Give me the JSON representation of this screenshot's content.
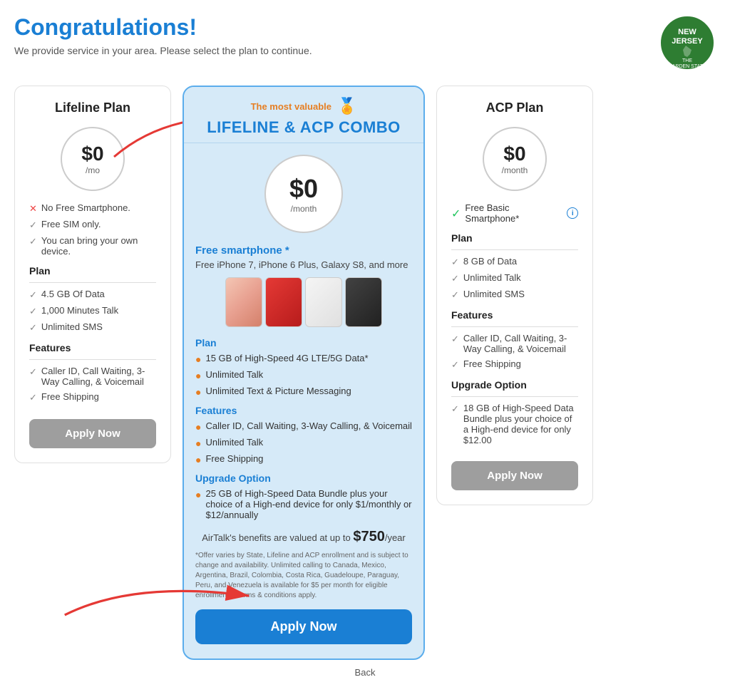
{
  "header": {
    "title": "Congratulations!",
    "subtitle": "We provide service in your area. Please select the plan to continue."
  },
  "lifeline": {
    "title": "Lifeline Plan",
    "price": "$0",
    "period": "/mo",
    "features_top": [
      {
        "type": "cross",
        "text": "No Free Smartphone."
      },
      {
        "type": "check",
        "text": "Free SIM only."
      },
      {
        "type": "check",
        "text": "You can bring your own device."
      }
    ],
    "plan_label": "Plan",
    "plan_items": [
      "4.5 GB Of Data",
      "1,000 Minutes Talk",
      "Unlimited SMS"
    ],
    "features_label": "Features",
    "features_items": [
      "Caller ID, Call Waiting, 3-Way Calling, & Voicemail",
      "Free Shipping"
    ],
    "apply_btn": "Apply Now"
  },
  "combo": {
    "badge": "The most valuable",
    "title": "LIFELINE & ACP COMBO",
    "price": "$0",
    "period": "/month",
    "free_smartphone_label": "Free smartphone *",
    "free_smartphone_desc": "Free iPhone 7, iPhone 6 Plus, Galaxy S8, and more",
    "plan_label": "Plan",
    "plan_items": [
      "15 GB of High-Speed 4G LTE/5G Data*",
      "Unlimited Talk",
      "Unlimited Text & Picture Messaging"
    ],
    "features_label": "Features",
    "features_items": [
      "Caller ID, Call Waiting, 3-Way Calling, & Voicemail",
      "Unlimited Talk",
      "Free Shipping"
    ],
    "upgrade_label": "Upgrade Option",
    "upgrade_items": [
      "25 GB of High-Speed Data Bundle plus your choice of a High-end device for only $1/monthly or $12/annually"
    ],
    "airtalk_value_text": "AirTalk's benefits are valued at up to",
    "airtalk_value_amount": "$750",
    "airtalk_value_period": "/year",
    "disclaimer": "*Offer varies by State, Lifeline and ACP enrollment and is subject to change and availability. Unlimited calling to Canada, Mexico, Argentina, Brazil, Colombia, Costa Rica, Guadeloupe, Paraguay, Peru, and Venezuela is available for $5 per month for eligible enrollments. Terms & conditions apply.",
    "apply_btn": "Apply Now",
    "back_link": "Back"
  },
  "acp": {
    "title": "ACP Plan",
    "price": "$0",
    "period": "/month",
    "free_phone_label": "Free Basic Smartphone*",
    "plan_label": "Plan",
    "plan_items": [
      "8 GB of Data",
      "Unlimited Talk",
      "Unlimited SMS"
    ],
    "features_label": "Features",
    "features_items": [
      "Caller ID, Call Waiting, 3-Way Calling, & Voicemail",
      "Free Shipping"
    ],
    "upgrade_label": "Upgrade Option",
    "upgrade_items": [
      "18 GB of High-Speed Data Bundle plus your choice of a High-end device for only $12.00"
    ],
    "apply_btn": "Apply Now"
  },
  "icons": {
    "medal": "🏅",
    "check_gray": "✓",
    "check_green": "✓",
    "cross_red": "✕",
    "orange_circle": "●",
    "info": "i"
  }
}
